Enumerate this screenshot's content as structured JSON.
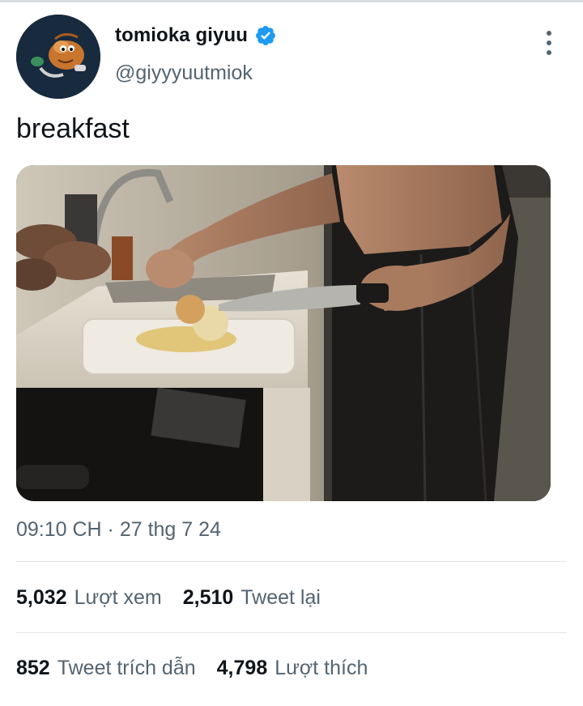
{
  "tweet": {
    "author": {
      "display_name": "tomioka giyuu",
      "handle": "@giyyyuutmiok",
      "verified": true
    },
    "text": "breakfast",
    "timestamp": "09:10 CH · 27 thg 7 24"
  },
  "stats": {
    "views": {
      "count": "5,032",
      "label": "Lượt xem"
    },
    "retweets": {
      "count": "2,510",
      "label": "Tweet lại"
    },
    "quotes": {
      "count": "852",
      "label": "Tweet trích dẫn"
    },
    "likes": {
      "count": "4,798",
      "label": "Lượt thích"
    }
  },
  "colors": {
    "text_primary": "#0f1419",
    "text_secondary": "#536471",
    "verified_blue": "#1d9bf0",
    "divider": "#e3e6e8"
  },
  "icons": {
    "verified": "verified-badge-icon",
    "more": "more-vertical-icon"
  }
}
